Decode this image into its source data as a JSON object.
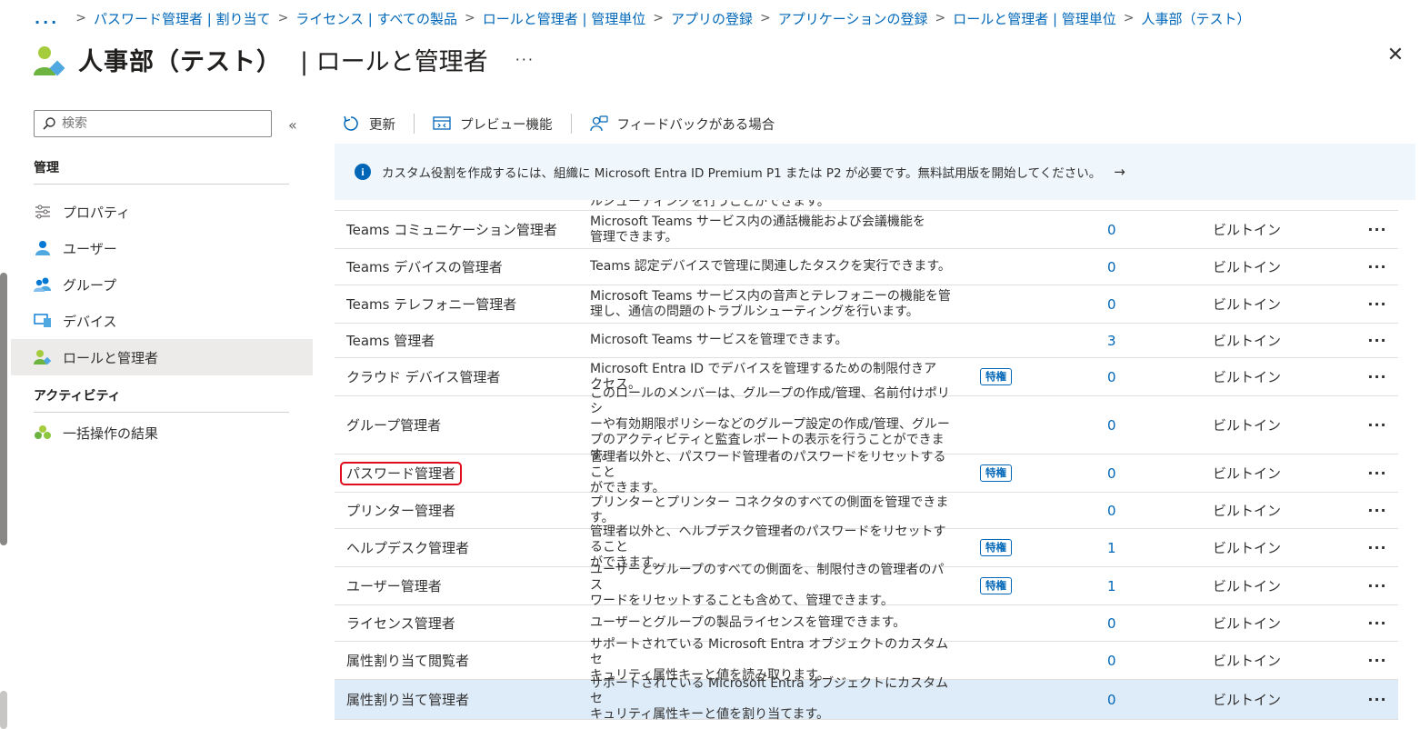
{
  "breadcrumb": {
    "more": "...",
    "items": [
      "パスワード管理者 | 割り当て",
      "ライセンス | すべての製品",
      "ロールと管理者 | 管理単位",
      "アプリの登録",
      "アプリケーションの登録",
      "ロールと管理者 | 管理単位",
      "人事部（テスト）"
    ]
  },
  "header": {
    "title": "人事部（テスト）",
    "subtitle": "| ロールと管理者",
    "more": "···",
    "close": "✕"
  },
  "sidebar": {
    "search_placeholder": "検索",
    "collapse": "«",
    "section_manage": "管理",
    "manage_items": [
      {
        "label": "プロパティ",
        "icon": "properties-icon"
      },
      {
        "label": "ユーザー",
        "icon": "user-icon"
      },
      {
        "label": "グループ",
        "icon": "group-icon"
      },
      {
        "label": "デバイス",
        "icon": "device-icon"
      },
      {
        "label": "ロールと管理者",
        "icon": "roles-icon"
      }
    ],
    "section_activity": "アクティビティ",
    "activity_items": [
      {
        "label": "一括操作の結果",
        "icon": "bulk-operations-icon"
      }
    ]
  },
  "toolbar": {
    "refresh": "更新",
    "preview": "プレビュー機能",
    "feedback": "フィードバックがある場合"
  },
  "banner": {
    "text": "カスタム役割を作成するには、組織に Microsoft Entra ID Premium P1 または P2 が必要です。無料試用版を開始してください。",
    "arrow": "→"
  },
  "table": {
    "cut_text": "ルシューティングを行うことができます。",
    "rows": [
      {
        "name": "Teams コミュニケーション管理者",
        "desc": [
          "Microsoft Teams サービス内の通話機能および会議機能を",
          "管理できます。"
        ],
        "badge": "",
        "count": "0",
        "type": "ビルトイン"
      },
      {
        "name": "Teams デバイスの管理者",
        "desc": [
          "Teams 認定デバイスで管理に関連したタスクを実行できます。"
        ],
        "badge": "",
        "count": "0",
        "type": "ビルトイン"
      },
      {
        "name": "Teams テレフォニー管理者",
        "desc": [
          "Microsoft Teams サービス内の音声とテレフォニーの機能を管",
          "理し、通信の問題のトラブルシューティングを行います。"
        ],
        "badge": "",
        "count": "0",
        "type": "ビルトイン"
      },
      {
        "name": "Teams 管理者",
        "desc": [
          "Microsoft Teams サービスを管理できます。"
        ],
        "badge": "",
        "count": "3",
        "type": "ビルトイン"
      },
      {
        "name": "クラウド デバイス管理者",
        "desc": [
          "Microsoft Entra ID でデバイスを管理するための制限付きア",
          "クセス。"
        ],
        "badge": "特権",
        "count": "0",
        "type": "ビルトイン"
      },
      {
        "name": "グループ管理者",
        "desc": [
          "このロールのメンバーは、グループの作成/管理、名前付けポリシ",
          "ーや有効期限ポリシーなどのグループ設定の作成/管理、グルー",
          "プのアクティビティと監査レポートの表示を行うことができます。"
        ],
        "badge": "",
        "count": "0",
        "type": "ビルトイン"
      },
      {
        "name": "パスワード管理者",
        "desc": [
          "管理者以外と、パスワード管理者のパスワードをリセットすること",
          "ができます。"
        ],
        "badge": "特権",
        "count": "0",
        "type": "ビルトイン",
        "highlighted": true
      },
      {
        "name": "プリンター管理者",
        "desc": [
          "プリンターとプリンター コネクタのすべての側面を管理できます。"
        ],
        "badge": "",
        "count": "0",
        "type": "ビルトイン"
      },
      {
        "name": "ヘルプデスク管理者",
        "desc": [
          "管理者以外と、ヘルプデスク管理者のパスワードをリセットすること",
          "ができます。"
        ],
        "badge": "特権",
        "count": "1",
        "type": "ビルトイン"
      },
      {
        "name": "ユーザー管理者",
        "desc": [
          "ユーザーとグループのすべての側面を、制限付きの管理者のパス",
          "ワードをリセットすることも含めて、管理できます。"
        ],
        "badge": "特権",
        "count": "1",
        "type": "ビルトイン"
      },
      {
        "name": "ライセンス管理者",
        "desc": [
          "ユーザーとグループの製品ライセンスを管理できます。"
        ],
        "badge": "",
        "count": "0",
        "type": "ビルトイン"
      },
      {
        "name": "属性割り当て閲覧者",
        "desc": [
          "サポートされている Microsoft Entra オブジェクトのカスタム セ",
          "キュリティ属性キーと値を読み取ります。"
        ],
        "badge": "",
        "count": "0",
        "type": "ビルトイン"
      },
      {
        "name": "属性割り当て管理者",
        "desc": [
          "サポートされている Microsoft Entra オブジェクトにカスタム セ",
          "キュリティ属性キーと値を割り当てます。"
        ],
        "badge": "",
        "count": "0",
        "type": "ビルトイン",
        "selected": true
      }
    ],
    "more": "···"
  }
}
